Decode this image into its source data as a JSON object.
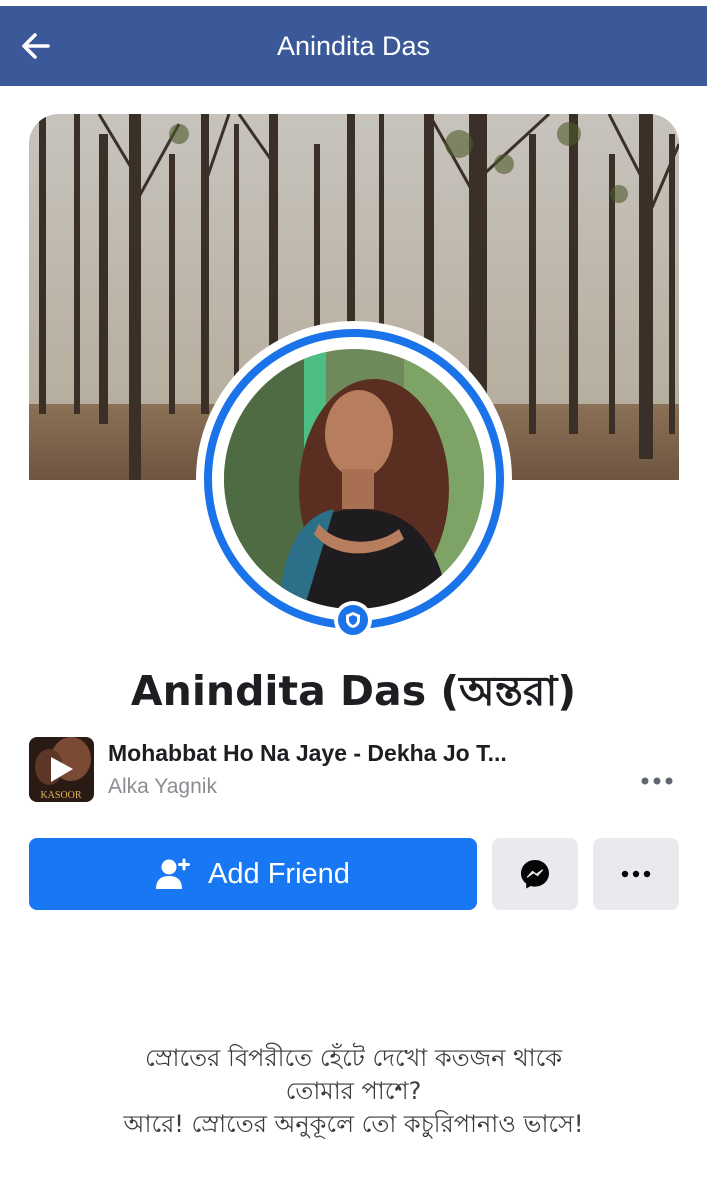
{
  "header": {
    "title": "Anindita Das"
  },
  "profile": {
    "name": "Anindita Das (অন্তরা)"
  },
  "music": {
    "title": "Mohabbat Ho Na Jaye - Dekha Jo T...",
    "artist": "Alka Yagnik",
    "album_art_text": "KASOOR"
  },
  "actions": {
    "add_friend_label": "Add Friend"
  },
  "bio": {
    "lines": [
      "স্রোতের বিপরীতে হেঁটে দেখো কতজন থাকে",
      "তোমার পাশে?",
      "আরে! স্রোতের অনুকূলে তো কচুরিপানাও ভাসে!"
    ]
  },
  "colors": {
    "header_bg": "#3b5998",
    "primary_button": "#1877f2",
    "secondary_button": "#e9eaee",
    "avatar_ring": "#1a73e8"
  }
}
